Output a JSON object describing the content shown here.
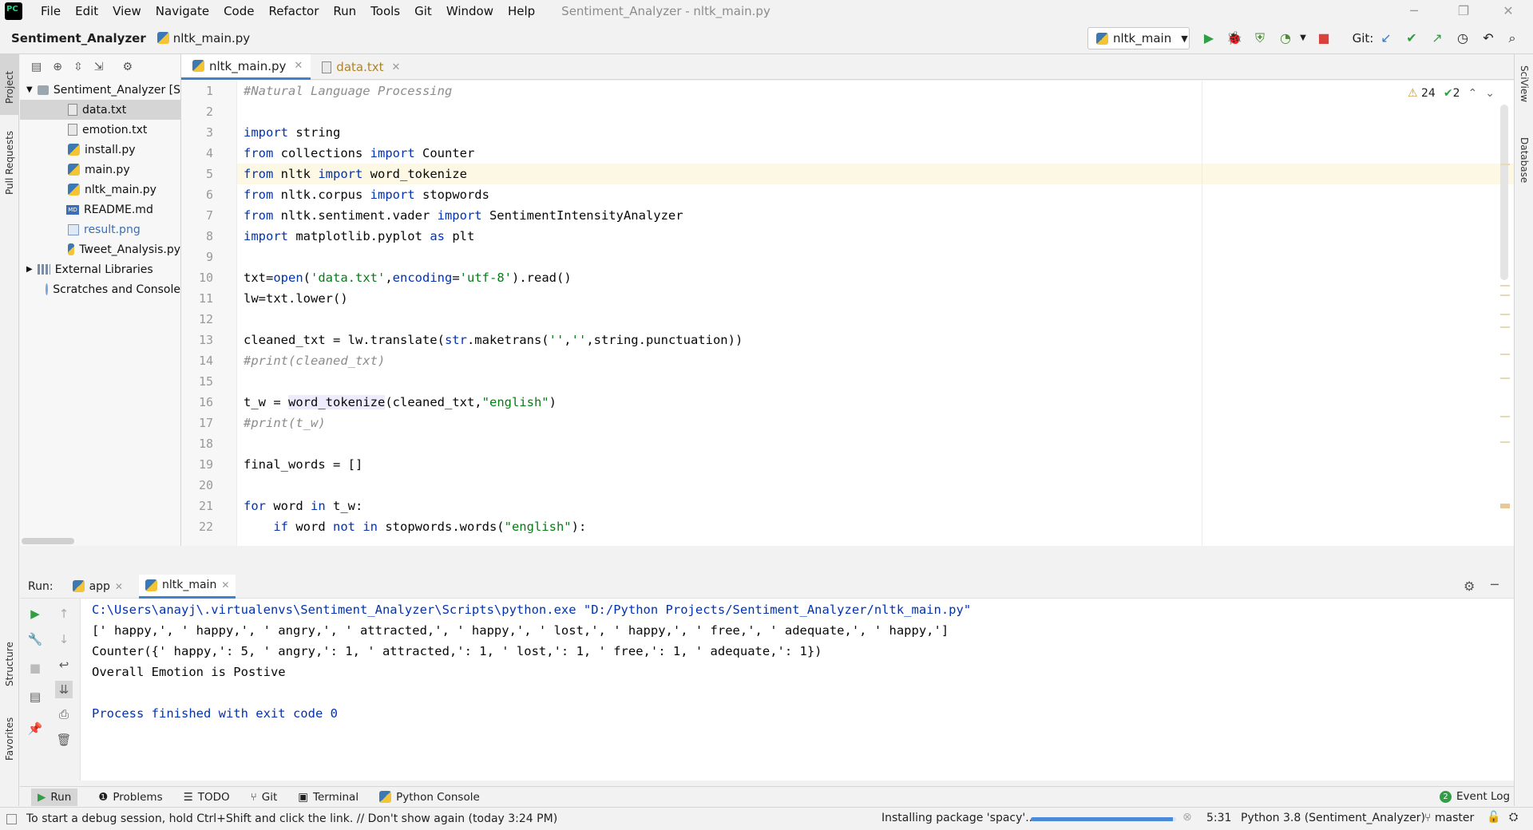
{
  "menubar": {
    "items": [
      "File",
      "Edit",
      "View",
      "Navigate",
      "Code",
      "Refactor",
      "Run",
      "Tools",
      "Git",
      "Window",
      "Help"
    ],
    "window_title": "Sentiment_Analyzer - nltk_main.py"
  },
  "navbar": {
    "project": "Sentiment_Analyzer",
    "file": "nltk_main.py",
    "run_config": "nltk_main",
    "git_label": "Git:"
  },
  "left_stripe": {
    "project": "Project",
    "pull_requests": "Pull Requests",
    "structure": "Structure",
    "favorites": "Favorites"
  },
  "right_stripe": {
    "sciview": "SciView",
    "database": "Database"
  },
  "project_tree": {
    "root": "Sentiment_Analyzer [S",
    "files": [
      {
        "name": "data.txt",
        "type": "txt"
      },
      {
        "name": "emotion.txt",
        "type": "txt"
      },
      {
        "name": "install.py",
        "type": "py"
      },
      {
        "name": "main.py",
        "type": "py"
      },
      {
        "name": "nltk_main.py",
        "type": "py"
      },
      {
        "name": "README.md",
        "type": "md"
      },
      {
        "name": "result.png",
        "type": "png"
      },
      {
        "name": "Tweet_Analysis.py",
        "type": "py"
      }
    ],
    "external": "External Libraries",
    "scratches": "Scratches and Console"
  },
  "tabs": [
    {
      "label": "nltk_main.py",
      "active": true
    },
    {
      "label": "data.txt",
      "active": false
    }
  ],
  "inspections": {
    "warnings": "24",
    "weak": "2"
  },
  "code": {
    "line_numbers": [
      "1",
      "2",
      "3",
      "4",
      "5",
      "6",
      "7",
      "8",
      "9",
      "10",
      "11",
      "12",
      "13",
      "14",
      "15",
      "16",
      "17",
      "18",
      "19",
      "20",
      "21",
      "22"
    ],
    "current_line": 5
  },
  "run": {
    "label": "Run:",
    "tabs": [
      "app",
      "nltk_main"
    ],
    "output": [
      "C:\\Users\\anayj\\.virtualenvs\\Sentiment_Analyzer\\Scripts\\python.exe \"D:/Python Projects/Sentiment_Analyzer/nltk_main.py\"",
      "[' happy,', ' happy,', ' angry,', ' attracted,', ' happy,', ' lost,', ' happy,', ' free,', ' adequate,', ' happy,']",
      "Counter({' happy,': 5, ' angry,': 1, ' attracted,': 1, ' lost,': 1, ' free,': 1, ' adequate,': 1})",
      "Overall Emotion is Postive",
      "",
      "Process finished with exit code 0"
    ]
  },
  "bottom_tools": [
    "Run",
    "Problems",
    "TODO",
    "Git",
    "Terminal",
    "Python Console"
  ],
  "event_log": {
    "count": "2",
    "label": "Event Log"
  },
  "status": {
    "message": "To start a debug session, hold Ctrl+Shift and click the link. // Don't show again (today 3:24 PM)",
    "task": "Installing package 'spacy'...",
    "progress": 0.98,
    "position": "5:31",
    "interpreter": "Python 3.8 (Sentiment_Analyzer)",
    "branch": "master"
  }
}
